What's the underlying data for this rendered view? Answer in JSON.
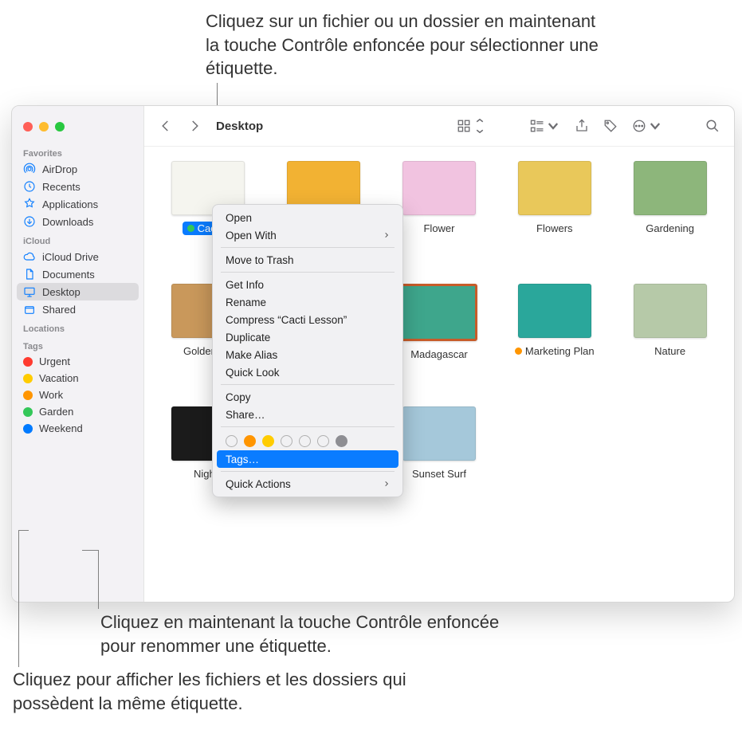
{
  "annotations": {
    "top": "Cliquez sur un fichier ou un dossier en maintenant la touche Contrôle enfoncée pour sélectionner une étiquette.",
    "mid": "Cliquez en maintenant la touche Contrôle enfoncée pour renommer une étiquette.",
    "bottom": "Cliquez pour afficher les fichiers et les dossiers qui possèdent la même étiquette."
  },
  "toolbar": {
    "title": "Desktop"
  },
  "sidebar": {
    "favorites_header": "Favorites",
    "favorites": [
      {
        "label": "AirDrop",
        "icon": "airdrop"
      },
      {
        "label": "Recents",
        "icon": "clock"
      },
      {
        "label": "Applications",
        "icon": "apps"
      },
      {
        "label": "Downloads",
        "icon": "download"
      }
    ],
    "icloud_header": "iCloud",
    "icloud": [
      {
        "label": "iCloud Drive",
        "icon": "cloud"
      },
      {
        "label": "Documents",
        "icon": "doc"
      },
      {
        "label": "Desktop",
        "icon": "desktop",
        "selected": true
      },
      {
        "label": "Shared",
        "icon": "shared"
      }
    ],
    "locations_header": "Locations",
    "tags_header": "Tags",
    "tags": [
      {
        "label": "Urgent",
        "color": "#ff3b30"
      },
      {
        "label": "Vacation",
        "color": "#ffcc00"
      },
      {
        "label": "Work",
        "color": "#ff9500"
      },
      {
        "label": "Garden",
        "color": "#34c759"
      },
      {
        "label": "Weekend",
        "color": "#007aff"
      }
    ]
  },
  "files": [
    {
      "label": "Cacti L",
      "tag_color": "#34c759",
      "selected": true,
      "bg": "#f5f5ef"
    },
    {
      "label": "",
      "bg": "#f2b233",
      "hidden_label": true
    },
    {
      "label": "Flower",
      "bg": "#f1c3e0"
    },
    {
      "label": "Flowers",
      "bg": "#e9c85a"
    },
    {
      "label": "Gardening",
      "bg": "#8db67b"
    },
    {
      "label": "Golden Ga",
      "bg": "#c9985b"
    },
    {
      "label": "",
      "hidden_label": true,
      "bg": "#bfbfbf"
    },
    {
      "label": "Madagascar",
      "bg": "#3ea68c",
      "border": "#c75c2a"
    },
    {
      "label": "Marketing Plan",
      "tag_color": "#ff9500",
      "bg": "#2aa79b"
    },
    {
      "label": "Nature",
      "bg": "#b6c9a8"
    },
    {
      "label": "Nightti",
      "bg": "#1b1b1b"
    },
    {
      "label": "",
      "hidden_label": true,
      "bg": "#bfbfbf"
    },
    {
      "label": "Sunset Surf",
      "bg": "#a5c8da"
    }
  ],
  "context_menu": {
    "open": "Open",
    "open_with": "Open With",
    "move_to_trash": "Move to Trash",
    "get_info": "Get Info",
    "rename": "Rename",
    "compress": "Compress “Cacti Lesson”",
    "duplicate": "Duplicate",
    "make_alias": "Make Alias",
    "quick_look": "Quick Look",
    "copy": "Copy",
    "share": "Share…",
    "tags": "Tags…",
    "quick_actions": "Quick Actions",
    "tag_colors": [
      {
        "fill": "none",
        "stroke": "#b0b0b0"
      },
      {
        "fill": "#ff9500",
        "stroke": "#ff9500"
      },
      {
        "fill": "#ffcc00",
        "stroke": "#ffcc00"
      },
      {
        "fill": "none",
        "stroke": "#b0b0b0"
      },
      {
        "fill": "none",
        "stroke": "#b0b0b0"
      },
      {
        "fill": "none",
        "stroke": "#b0b0b0"
      },
      {
        "fill": "#8e8e93",
        "stroke": "#8e8e93"
      }
    ]
  }
}
